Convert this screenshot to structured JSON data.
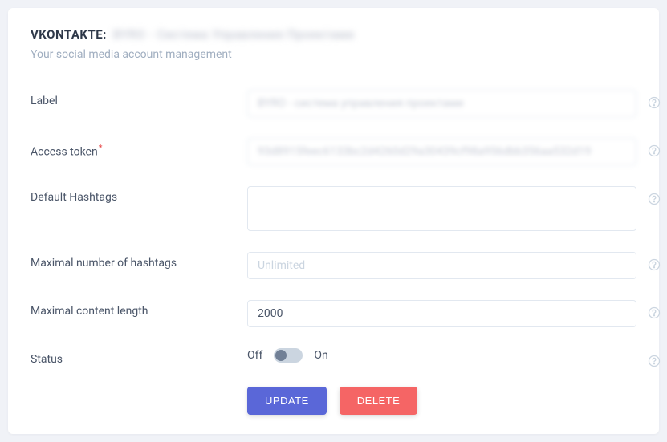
{
  "header": {
    "title_prefix": "VKONTAKTE:",
    "title_blurred": "BYRO - Система Управления Проектами"
  },
  "subtitle": "Your social media account management",
  "fields": {
    "label": {
      "label": "Label",
      "value": "BYRO - система управления проектами"
    },
    "access_token": {
      "label": "Access token",
      "value": "93d8915feec6133bc2d4260d29a30439cf98a956dbb356aa532d19"
    },
    "default_hashtags": {
      "label": "Default Hashtags",
      "value": ""
    },
    "max_hashtags": {
      "label": "Maximal number of hashtags",
      "placeholder": "Unlimited",
      "value": ""
    },
    "max_content_length": {
      "label": "Maximal content length",
      "value": "2000"
    },
    "status": {
      "label": "Status",
      "off_label": "Off",
      "on_label": "On"
    }
  },
  "buttons": {
    "update": "UPDATE",
    "delete": "DELETE"
  }
}
